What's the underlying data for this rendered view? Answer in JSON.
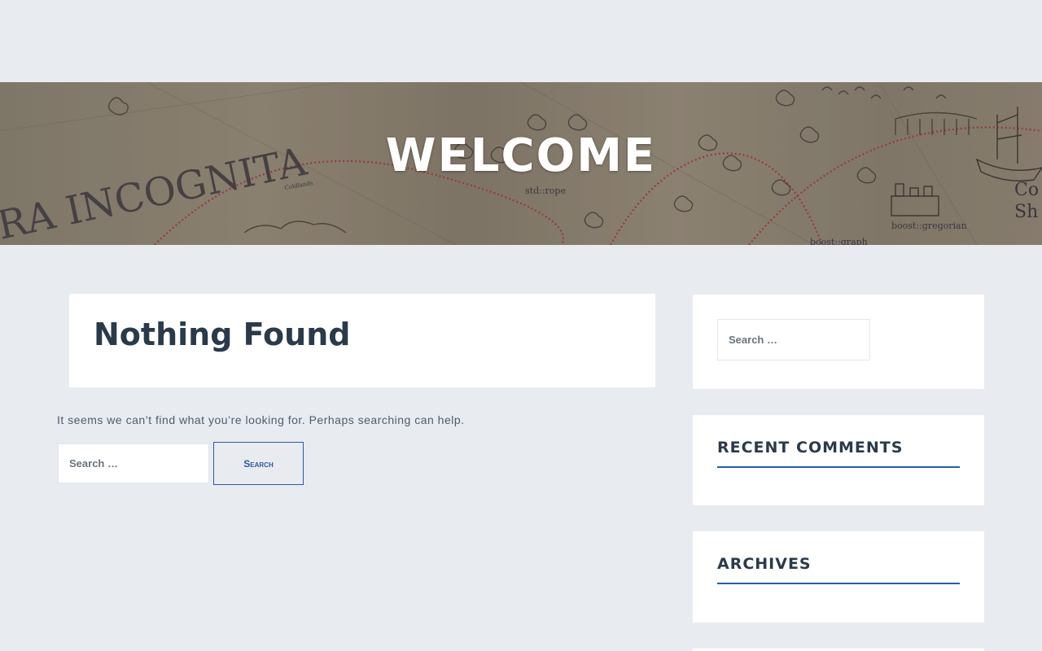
{
  "hero": {
    "title": "WELCOME",
    "map_labels": {
      "terra": "RA INCOGNITA",
      "rope": "std::rope",
      "gregorian": "boost::gregorian",
      "graph": "boost::graph",
      "edge_word": "Co",
      "edge_word2": "Sh",
      "small": "Coldlands"
    }
  },
  "main": {
    "title": "Nothing Found",
    "message": "It seems we can’t find what you’re looking for. Perhaps searching can help.",
    "search": {
      "placeholder": "Search …",
      "button_label": "Search"
    }
  },
  "sidebar": {
    "search_placeholder": "Search …",
    "recent_comments_title": "RECENT COMMENTS",
    "archives_title": "ARCHIVES"
  },
  "colors": {
    "background": "#e8ebf0",
    "accent": "#2c5aa0",
    "heading": "#2a3a4b"
  }
}
